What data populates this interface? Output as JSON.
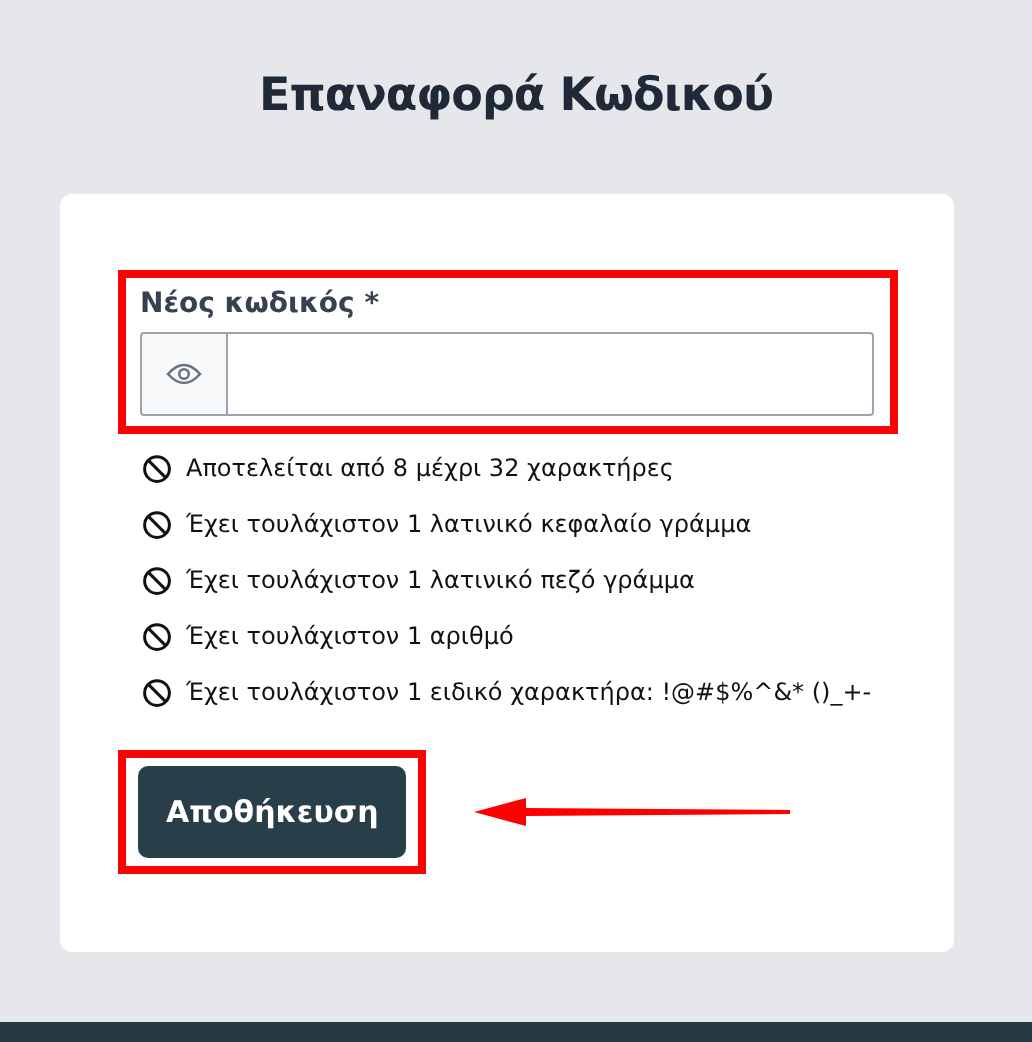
{
  "title": "Επαναφορά Κωδικού",
  "form": {
    "field": {
      "label": "Νέος κωδικός *",
      "highlighted": true
    },
    "rules": [
      {
        "text": "Αποτελείται από 8 μέχρι 32 χαρακτήρες",
        "met": false
      },
      {
        "text": "Έχει τουλάχιστον 1 λατινικό κεφαλαίο γράμμα",
        "met": false
      },
      {
        "text": "Έχει τουλάχιστον 1 λατινικό πεζό γράμμα",
        "met": false
      },
      {
        "text": "Έχει τουλάχιστον 1 αριθμό",
        "met": false
      },
      {
        "text": "Έχει τουλάχιστον 1 ειδικό χαρακτήρα: !@#$%^&* ()_+-",
        "met": false
      }
    ],
    "save_button": {
      "label": "Αποθήκευση",
      "highlighted": true,
      "arrow": true
    }
  }
}
